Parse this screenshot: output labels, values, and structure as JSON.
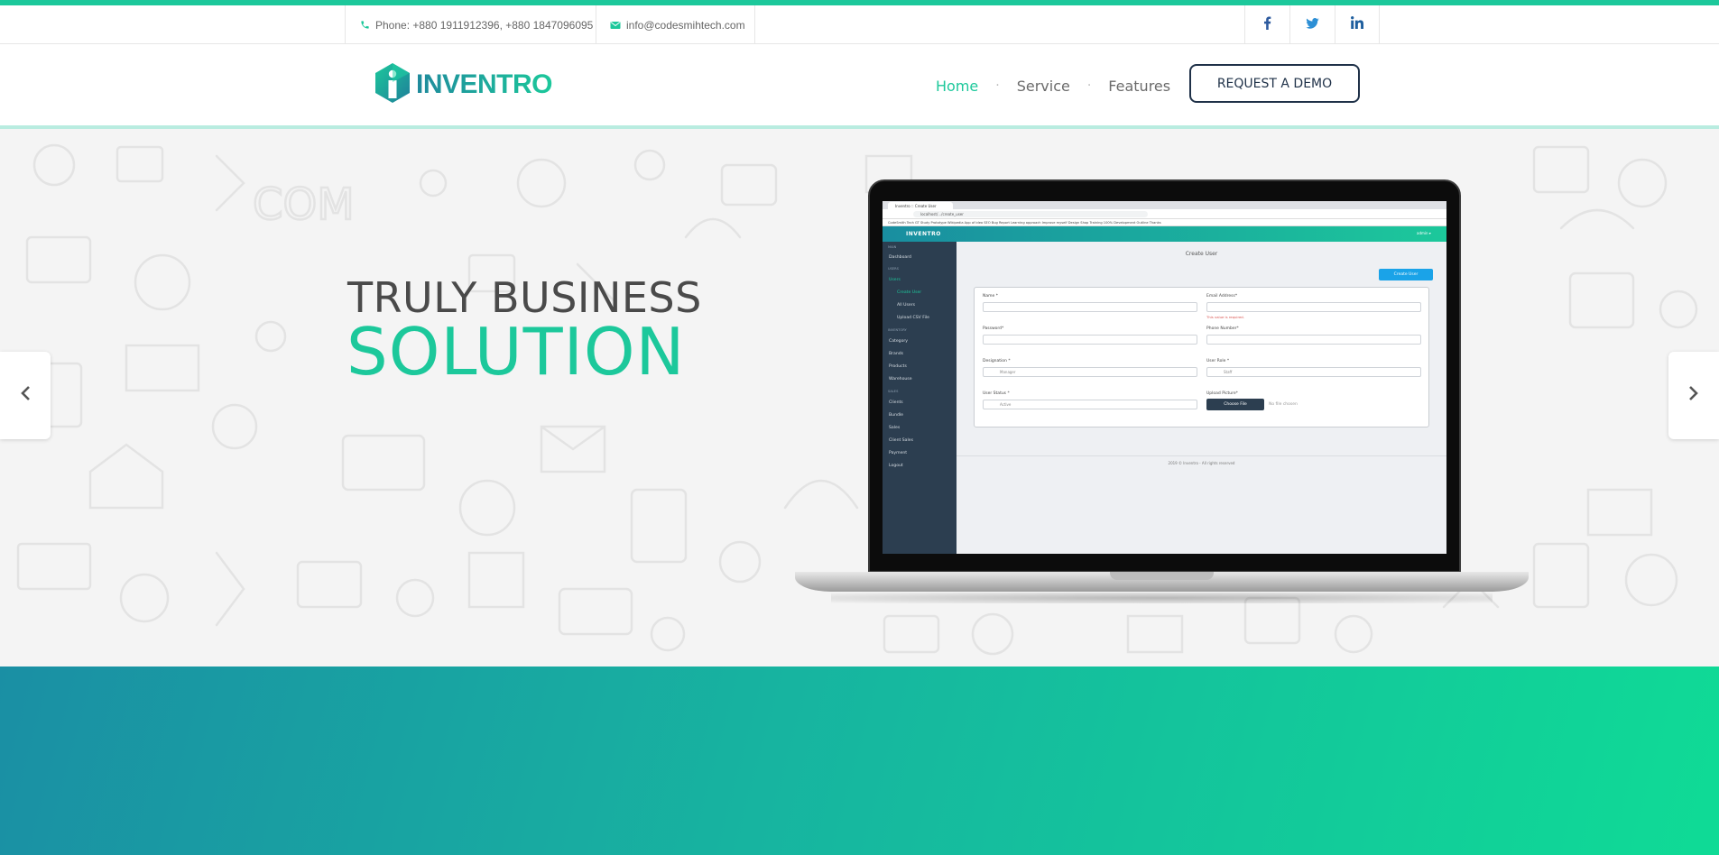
{
  "topbar": {
    "phone": "Phone: +880 1911912396, +880 1847096095",
    "email": "info@codesmihtech.com",
    "social": [
      "facebook-icon",
      "twitter-icon",
      "linkedin-icon"
    ]
  },
  "header": {
    "logo_text": "INVENTRO",
    "nav": {
      "home": "Home",
      "service": "Service",
      "features": "Features"
    },
    "demo_button": "REQUEST A DEMO"
  },
  "hero": {
    "line1": "TRULY BUSINESS",
    "line2": "SOLUTION"
  },
  "mockup": {
    "tab_title": "Inventro :: Create User",
    "url": "localhost/.../create_user",
    "bookmarks": "CodeSmith Tech   GT   Study   Prototype   Wikipedia   App of idea   SEO   Bug Report   Learning approach   Improve myself   Design   Shop   Training   100%   Development   Outline   Thanks",
    "brand": "INVENTRO",
    "admin": "admin ▾",
    "sidebar": {
      "main_section": "MAIN",
      "dashboard": "Dashboard",
      "users_section": "USERS",
      "users": "Users",
      "create_user": "Create User",
      "all_users": "All Users",
      "upload_csv": "Upload CSV File",
      "inventory_section": "INVENTORY",
      "category": "Category",
      "brands": "Brands",
      "products": "Products",
      "warehouse": "Warehouse",
      "sales_section": "SALES",
      "clients": "Clients",
      "bundle": "Bundle",
      "sales": "Sales",
      "client_sales": "Client Sales",
      "payment": "Payment",
      "logout": "Logout"
    },
    "page_title": "Create User",
    "create_button": "Create User",
    "form": {
      "name_label": "Name *",
      "email_label": "Email Address*",
      "email_error": "This value is required.",
      "password_label": "Password*",
      "phone_label": "Phone Number*",
      "designation_label": "Designation *",
      "designation_value": "Manager",
      "role_label": "User Role *",
      "role_value": "Staff",
      "status_label": "User Status *",
      "status_value": "Active",
      "picture_label": "Upload Picture*",
      "choose_file": "Choose File",
      "no_file": "No file chosen"
    },
    "footer": "2019 © Inventro - All rights reserved"
  },
  "colors": {
    "accent": "#1cc89b",
    "navy": "#1f3148",
    "sidebar": "#2c3e50",
    "band_start": "#1a8fa4",
    "band_end": "#0fdb96"
  }
}
